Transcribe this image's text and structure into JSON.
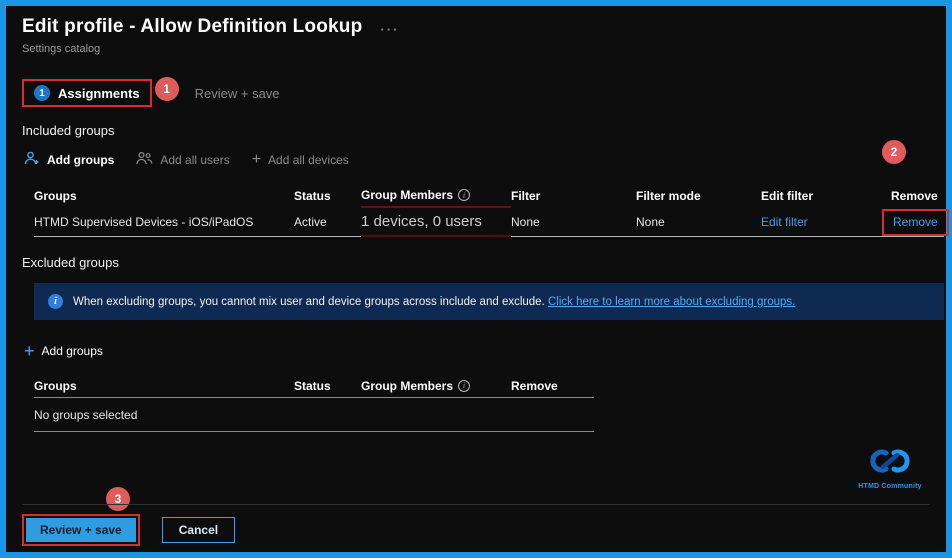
{
  "colors": {
    "frame_border": "#1b95e6",
    "annotation_red_box": "#d32f2f",
    "annotation_badge_red": "#e05c5c",
    "link_blue": "#3f9ef0",
    "primary_button_bg": "#2f9ce0",
    "banner_bg": "#0e2a52",
    "step_circle_blue": "#1a78c8"
  },
  "header": {
    "title": "Edit profile - Allow Definition Lookup",
    "subtitle": "Settings catalog",
    "menu_ellipsis": "···"
  },
  "tabs": {
    "assignments": {
      "step": "1",
      "label": "Assignments"
    },
    "review_save": {
      "label": "Review + save"
    }
  },
  "badges": {
    "one": "1",
    "two": "2",
    "three": "3"
  },
  "icons": {
    "info_glyph": "i",
    "plus_glyph": "+"
  },
  "included": {
    "heading": "Included groups",
    "toolbar": {
      "add_groups": "Add groups",
      "add_all_users": "Add all users",
      "add_all_devices": "Add all devices"
    },
    "columns": {
      "groups": "Groups",
      "status": "Status",
      "group_members": "Group Members",
      "filter": "Filter",
      "filter_mode": "Filter mode",
      "edit_filter": "Edit filter",
      "remove": "Remove"
    },
    "row": {
      "group": "HTMD Supervised Devices - iOS/iPadOS",
      "status": "Active",
      "members": "1 devices, 0 users",
      "filter": "None",
      "filter_mode": "None",
      "edit_filter_link": "Edit filter",
      "remove_link": "Remove"
    }
  },
  "excluded": {
    "heading": "Excluded groups",
    "banner": {
      "text": "When excluding groups, you cannot mix user and device groups across include and exclude.",
      "link": "Click here to learn more about excluding groups."
    },
    "toolbar": {
      "add_groups": "Add groups"
    },
    "columns": {
      "groups": "Groups",
      "status": "Status",
      "group_members": "Group Members",
      "remove": "Remove"
    },
    "empty_text": "No groups selected"
  },
  "footer": {
    "review_save": "Review + save",
    "cancel": "Cancel"
  },
  "logo": {
    "caption": "HTMD Community"
  }
}
